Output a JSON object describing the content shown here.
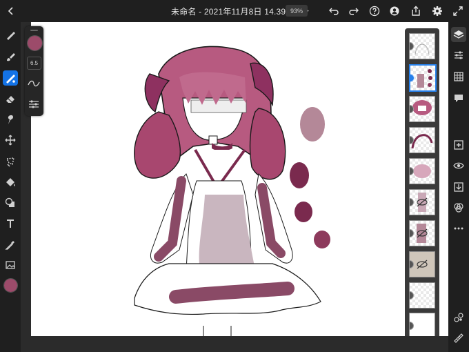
{
  "document": {
    "title": "未命名 - 2021年11月8日 14.39.18",
    "zoom": "93%"
  },
  "brush": {
    "color": "#9c4b6a",
    "size": "6.5"
  },
  "colors": {
    "accent": "#1473e6",
    "current_color": "#9c4b6a"
  },
  "left_tools": [
    {
      "name": "pixel-brush",
      "icon": "brush-icon"
    },
    {
      "name": "live-brush",
      "icon": "paint-brush-icon"
    },
    {
      "name": "vector-brush",
      "icon": "vector-brush-icon",
      "active": true
    },
    {
      "name": "eraser",
      "icon": "eraser-icon"
    },
    {
      "name": "smudge",
      "icon": "smudge-icon"
    },
    {
      "name": "move",
      "icon": "move-icon"
    },
    {
      "name": "lasso",
      "icon": "lasso-icon"
    },
    {
      "name": "fill",
      "icon": "fill-icon"
    },
    {
      "name": "shape",
      "icon": "shape-icon"
    },
    {
      "name": "text",
      "icon": "text-icon"
    },
    {
      "name": "eyedropper",
      "icon": "eyedropper-icon"
    },
    {
      "name": "image",
      "icon": "image-icon"
    }
  ],
  "layers": [
    {
      "visible": true
    },
    {
      "visible": true,
      "selected": true
    },
    {
      "visible": true
    },
    {
      "visible": true
    },
    {
      "visible": true
    },
    {
      "visible": false
    },
    {
      "visible": false
    },
    {
      "visible": false
    },
    {
      "visible": true
    },
    {
      "visible": true
    }
  ]
}
